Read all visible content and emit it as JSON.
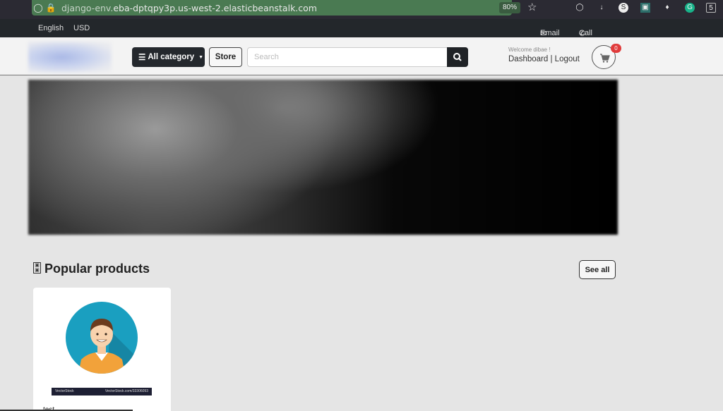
{
  "browser": {
    "url_prefix": "django-env.",
    "url_main": "eba-dptqpy3p.us-west-2.elasticbeanstalk.com",
    "zoom": "80%"
  },
  "topbar": {
    "language": "English",
    "currency": "USD",
    "email_label": "Email",
    "call_label": "Call us"
  },
  "header": {
    "category_label": "All category",
    "store_label": "Store",
    "search_placeholder": "Search",
    "welcome": "Welcome dibae !",
    "dashboard_label": "Dashboard",
    "separator": "|",
    "logout_label": "Logout",
    "cart_count": "0"
  },
  "main": {
    "section_title": "Popular products",
    "see_all_label": "See all",
    "products": [
      {
        "name": "test",
        "watermark_left": "VectorStock",
        "watermark_right": "VectorStock.com/33306093"
      }
    ]
  },
  "colors": {
    "topbar_bg": "#23272b",
    "header_bg": "#f3f3f3",
    "badge": "#e03b3b",
    "url_bar": "#4a7a52"
  }
}
